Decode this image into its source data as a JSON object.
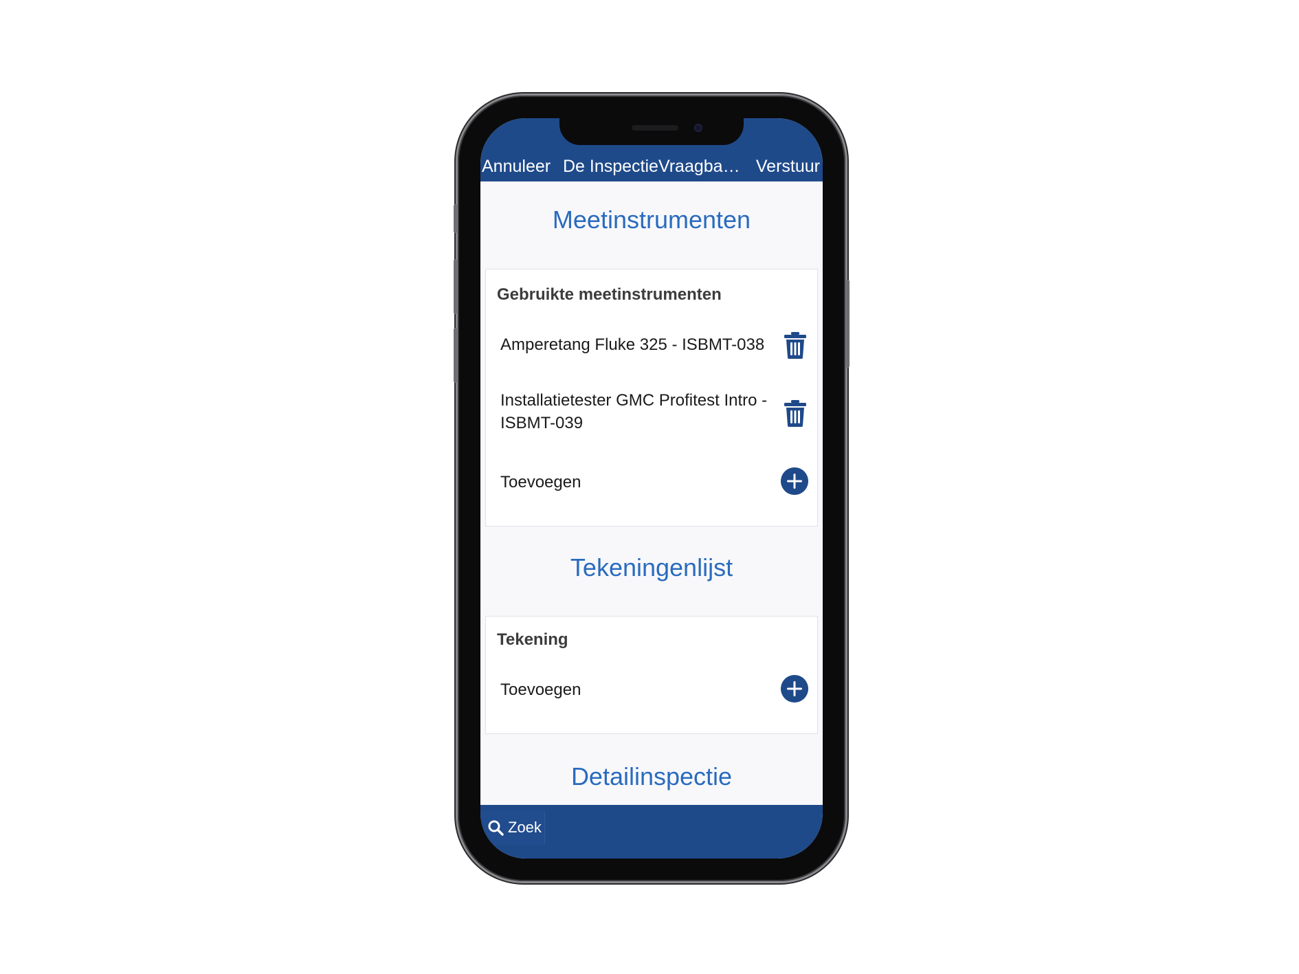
{
  "navbar": {
    "cancel_label": "Annuleer",
    "title": "De InspectieVraagbaak...",
    "send_label": "Verstuur"
  },
  "sections": {
    "meetinstrumenten": {
      "title": "Meetinstrumenten",
      "card_header": "Gebruikte meetinstrumenten",
      "items": [
        {
          "label": "Amperetang Fluke 325 - ISBMT-038"
        },
        {
          "label": "Installatietester GMC Profitest Intro - ISBMT-039"
        }
      ],
      "add_label": "Toevoegen"
    },
    "tekeningenlijst": {
      "title": "Tekeningenlijst",
      "card_header": "Tekening",
      "add_label": "Toevoegen"
    },
    "detailinspectie": {
      "title": "Detailinspectie"
    }
  },
  "tabbar": {
    "search_label": "Zoek",
    "search_icon": "search-icon"
  },
  "colors": {
    "brand": "#1f4a8a",
    "accent_title": "#2a6bbd",
    "background": "#f8f8fb"
  },
  "icons": {
    "delete": "trash-icon",
    "add": "plus-circle-icon"
  }
}
